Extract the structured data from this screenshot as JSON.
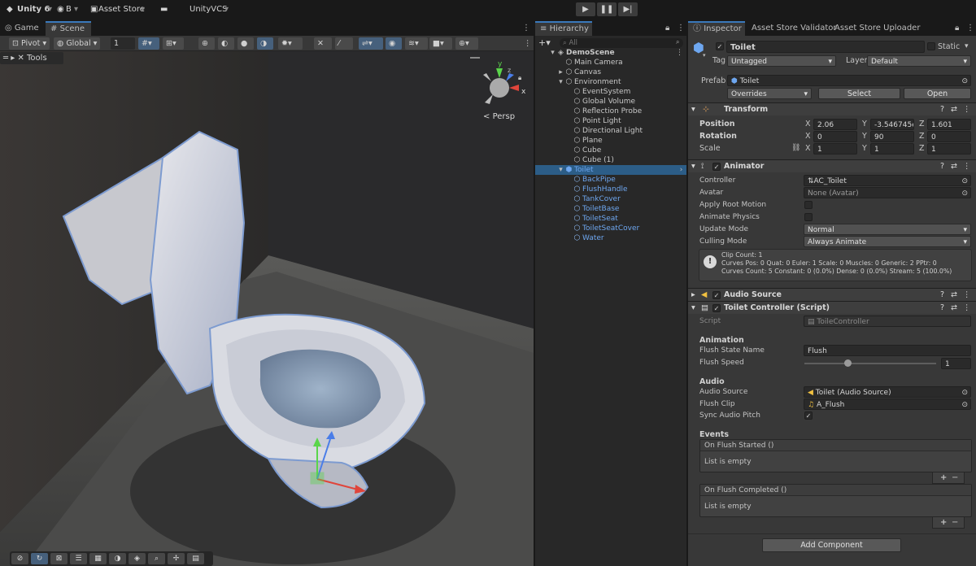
{
  "topbar": {
    "app_title": "Unity 6",
    "account": "B",
    "asset_store": "Asset Store",
    "vcs": "UnityVCS"
  },
  "scene_tabs": {
    "game": "Game",
    "scene": "Scene"
  },
  "scene_toolbar": {
    "pivot": "Pivot",
    "global": "Global",
    "snap_value": "1"
  },
  "scene_view": {
    "tools_label": "Tools",
    "projection": "Persp",
    "gizmo_x": "x",
    "gizmo_y": "y",
    "gizmo_z": "z"
  },
  "hierarchy": {
    "title": "Hierarchy",
    "search_placeholder": "All",
    "items": [
      {
        "label": "DemoScene"
      },
      {
        "label": "Main Camera"
      },
      {
        "label": "Canvas"
      },
      {
        "label": "Environment"
      },
      {
        "label": "EventSystem"
      },
      {
        "label": "Global Volume"
      },
      {
        "label": "Reflection Probe"
      },
      {
        "label": "Point Light"
      },
      {
        "label": "Directional Light"
      },
      {
        "label": "Plane"
      },
      {
        "label": "Cube"
      },
      {
        "label": "Cube (1)"
      },
      {
        "label": "Toilet"
      },
      {
        "label": "BackPipe"
      },
      {
        "label": "FlushHandle"
      },
      {
        "label": "TankCover"
      },
      {
        "label": "ToiletBase"
      },
      {
        "label": "ToiletSeat"
      },
      {
        "label": "ToiletSeatCover"
      },
      {
        "label": "Water"
      }
    ]
  },
  "inspector": {
    "tabs": [
      "Inspector",
      "Asset Store Validator",
      "Asset Store Uploader"
    ],
    "object_name": "Toilet",
    "static_label": "Static",
    "tag_label": "Tag",
    "tag_value": "Untagged",
    "layer_label": "Layer",
    "layer_value": "Default",
    "prefab_label": "Prefab",
    "prefab_value": "Toilet",
    "overrides": "Overrides",
    "select": "Select",
    "open": "Open",
    "transform": {
      "title": "Transform",
      "position_label": "Position",
      "rotation_label": "Rotation",
      "scale_label": "Scale",
      "axis_x": "X",
      "axis_y": "Y",
      "axis_z": "Z",
      "position": {
        "x": "2.06",
        "y": "-3.546745e",
        "z": "1.601"
      },
      "rotation": {
        "x": "0",
        "y": "90",
        "z": "0"
      },
      "scale": {
        "x": "1",
        "y": "1",
        "z": "1"
      }
    },
    "animator": {
      "title": "Animator",
      "controller_label": "Controller",
      "controller_value": "AC_Toilet",
      "avatar_label": "Avatar",
      "avatar_value": "None (Avatar)",
      "root_motion_label": "Apply Root Motion",
      "animate_physics_label": "Animate Physics",
      "update_mode_label": "Update Mode",
      "update_mode_value": "Normal",
      "culling_mode_label": "Culling Mode",
      "culling_mode_value": "Always Animate",
      "info_line1": "Clip Count: 1",
      "info_line2": "Curves Pos: 0 Quat: 0 Euler: 1 Scale: 0 Muscles: 0 Generic: 2 PPtr: 0",
      "info_line3": "Curves Count: 5 Constant: 0 (0.0%) Dense: 0 (0.0%) Stream: 5 (100.0%)"
    },
    "audio_source": {
      "title": "Audio Source"
    },
    "toilet_controller": {
      "title": "Toilet Controller (Script)",
      "script_label": "Script",
      "script_value": "ToileController",
      "animation_header": "Animation",
      "flush_state_label": "Flush State Name",
      "flush_state_value": "Flush",
      "flush_speed_label": "Flush Speed",
      "flush_speed_value": "1",
      "flush_speed_fraction": 0.33,
      "audio_header": "Audio",
      "audio_source_label": "Audio Source",
      "audio_source_value": "Toilet (Audio Source)",
      "flush_clip_label": "Flush Clip",
      "flush_clip_value": "A_Flush",
      "sync_pitch_label": "Sync Audio Pitch",
      "events_header": "Events",
      "event1_title": "On Flush Started ()",
      "event1_body": "List is empty",
      "event2_title": "On Flush Completed ()",
      "event2_body": "List is empty",
      "plus": "+",
      "minus": "−"
    },
    "add_component": "Add Component"
  }
}
